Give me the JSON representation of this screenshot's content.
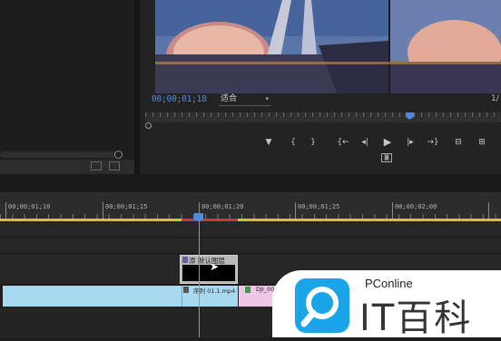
{
  "monitor": {
    "timecode": "00;00;01;18",
    "fit_select": "适合",
    "page_fraction": "1/"
  },
  "timeline": {
    "ruler_labels": [
      "00;00;01;10",
      "00;00;01;15",
      "00;00;01;20",
      "00;00;01;25",
      "00;00;02;00"
    ],
    "title_clip_label": "添 默认图层",
    "clip_b_label": "序列 01.1.mp4",
    "clip_c_label": "DJI_00"
  },
  "watermark": {
    "small_text": "PConline",
    "big_text": "IT百科"
  },
  "icons": [
    "marker-icon",
    "in-point-icon",
    "out-point-icon",
    "go-to-in-icon",
    "step-back-icon",
    "play-icon",
    "step-forward-icon",
    "go-to-out-icon",
    "lift-icon",
    "extract-icon",
    "camera-icon"
  ],
  "colors": {
    "timecode": "#4f8fe0",
    "playhead": "#4d8be0",
    "work_area": "#d6c32e",
    "clip_blue": "#a9d9f0",
    "clip_pink": "#f0c6e6",
    "brand": "#1aa5e8"
  }
}
